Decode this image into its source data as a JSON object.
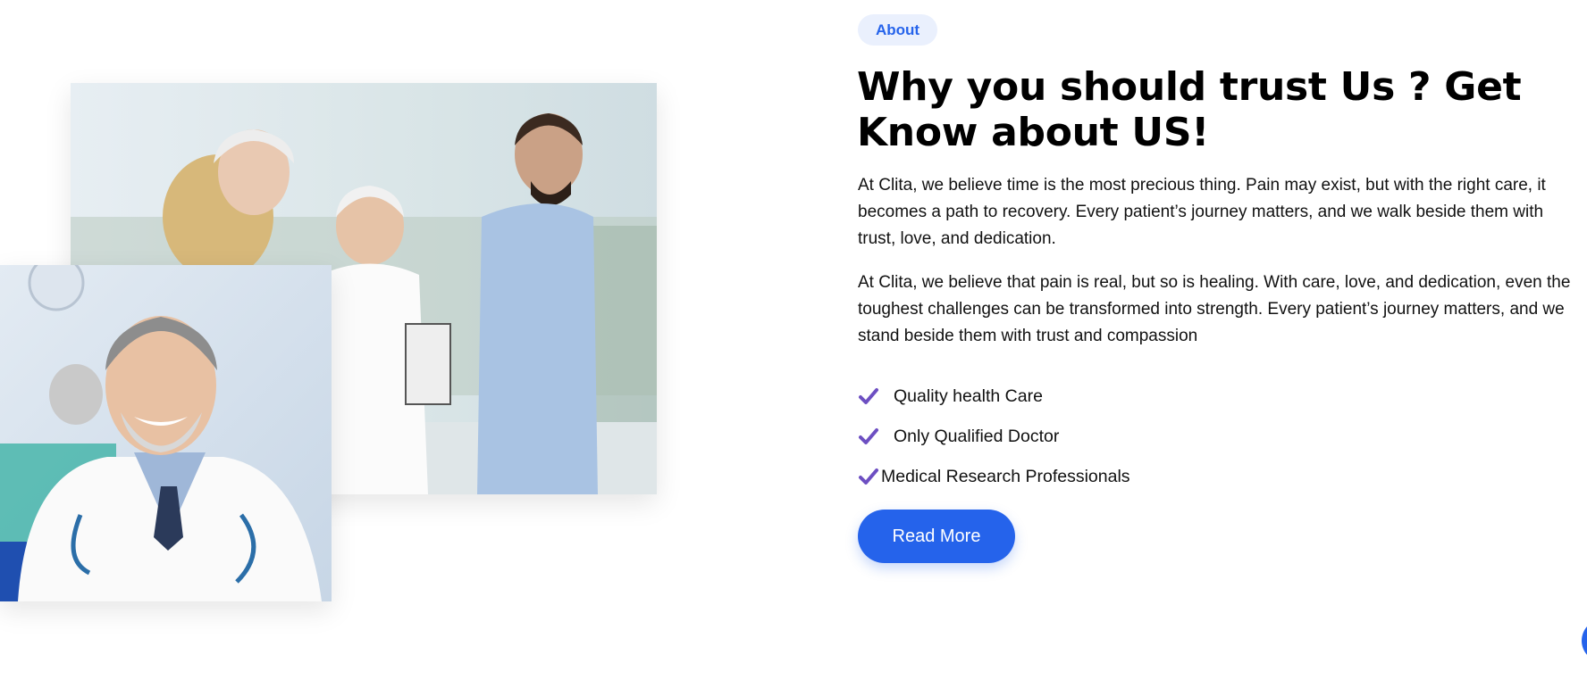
{
  "about_section": {
    "badge": "About",
    "heading": "Why you should trust Us ? Get Know about US!",
    "paragraphs": [
      "At Clita, we believe time is the most precious thing. Pain may exist, but with the right care, it becomes a path to recovery. Every patient’s journey matters, and we walk beside them with trust, love, and dedication.",
      "At Clita, we believe that pain is real, but so is healing. With care, love, and dedication, even the toughest challenges can be transformed into strength. Every patient’s journey matters, and we stand beside them with trust and compassion"
    ],
    "features": [
      {
        "label": "Quality health Care",
        "icon": "check-icon"
      },
      {
        "label": "Only Qualified Doctor",
        "icon": "check-icon"
      },
      {
        "label": "Medical Research Professionals",
        "icon": "check-icon"
      }
    ],
    "cta_label": "Read More"
  },
  "images": {
    "team_photo": "medical-team-photo",
    "doctor_photo": "smiling-doctor-photo"
  },
  "colors": {
    "accent": "#2563eb",
    "badge_bg": "#eaf0fd",
    "check": "#6d4fc2",
    "heading": "#000000",
    "body_text": "#111111"
  }
}
